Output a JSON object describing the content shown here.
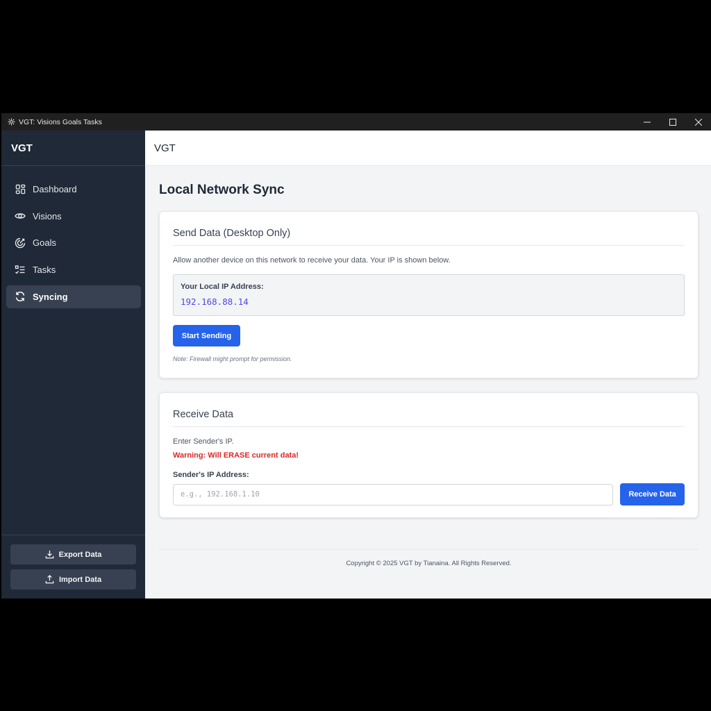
{
  "window": {
    "title": "VGT: Visions Goals Tasks",
    "app_icon": "gear-icon",
    "controls": [
      "minimize-icon",
      "maximize-icon",
      "close-icon"
    ]
  },
  "sidebar": {
    "brand": "VGT",
    "items": [
      {
        "label": "Dashboard",
        "icon": "dashboard-icon",
        "active": false
      },
      {
        "label": "Visions",
        "icon": "eye-icon",
        "active": false
      },
      {
        "label": "Goals",
        "icon": "target-icon",
        "active": false
      },
      {
        "label": "Tasks",
        "icon": "list-check-icon",
        "active": false
      },
      {
        "label": "Syncing",
        "icon": "sync-icon",
        "active": true
      }
    ],
    "export_label": "Export Data",
    "import_label": "Import Data"
  },
  "header": {
    "title": "VGT"
  },
  "main": {
    "page_title": "Local Network Sync",
    "send": {
      "title": "Send Data (Desktop Only)",
      "description": "Allow another device on this network to receive your data. Your IP is shown below.",
      "ip_label": "Your Local IP Address:",
      "ip_value": "192.168.88.14",
      "button_label": "Start Sending",
      "note": "Note: Firewall might prompt for permission."
    },
    "receive": {
      "title": "Receive Data",
      "instruction": "Enter Sender's IP.",
      "warning": "Warning: Will ERASE current data!",
      "field_label": "Sender's IP Address:",
      "input_value": "",
      "input_placeholder": "e.g., 192.168.1.10",
      "button_label": "Receive Data"
    }
  },
  "footer": {
    "copyright": "Copyright © 2025 VGT by Tianaina. All Rights Reserved."
  },
  "colors": {
    "sidebar_bg": "#1f2937",
    "active_item_bg": "#374151",
    "primary": "#2563eb",
    "warning": "#dc2626",
    "ip_text": "#4f46e5"
  }
}
